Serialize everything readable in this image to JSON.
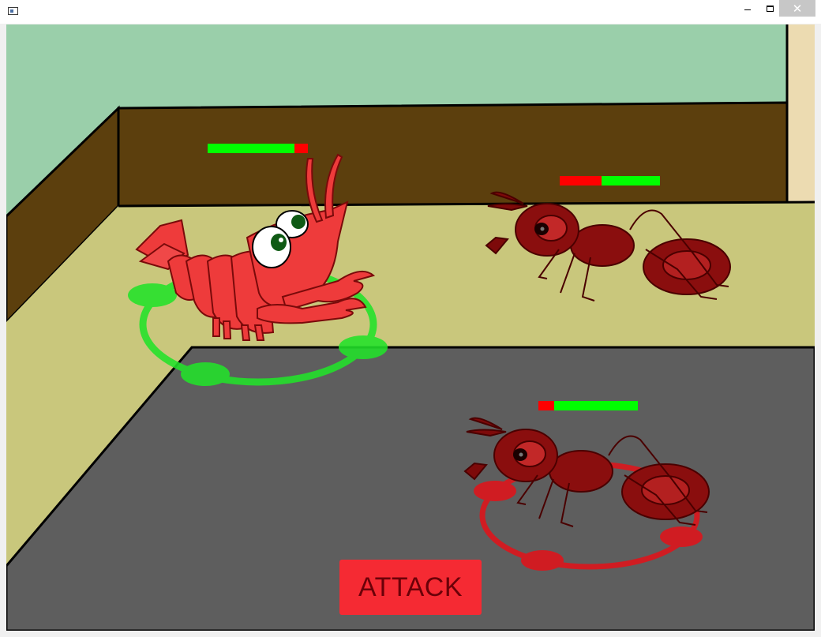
{
  "window": {
    "minimize_icon": "minimize-icon",
    "maximize_icon": "maximize-icon",
    "close_icon": "close-icon",
    "close_glyph": "✕"
  },
  "scene": {
    "colors": {
      "wall": "#9acfaa",
      "baseboard": "#5c3f0d",
      "floor": "#c9c77c",
      "pit": "#5e5e5e",
      "door": "#ecdbb1"
    }
  },
  "units": [
    {
      "name": "lobster",
      "team": "player",
      "selected": true,
      "health": 0.87,
      "ring_color": "#22e32a"
    },
    {
      "name": "ant",
      "team": "enemy",
      "selected": false,
      "health": 0.58,
      "ring_color": null
    },
    {
      "name": "ant",
      "team": "enemy",
      "selected": true,
      "health": 0.84,
      "ring_color": "#e0141a"
    }
  ],
  "health_colors": {
    "remaining": "#00ff00",
    "lost": "#ff0000"
  },
  "actions": {
    "attack_label": "ATTACK"
  }
}
